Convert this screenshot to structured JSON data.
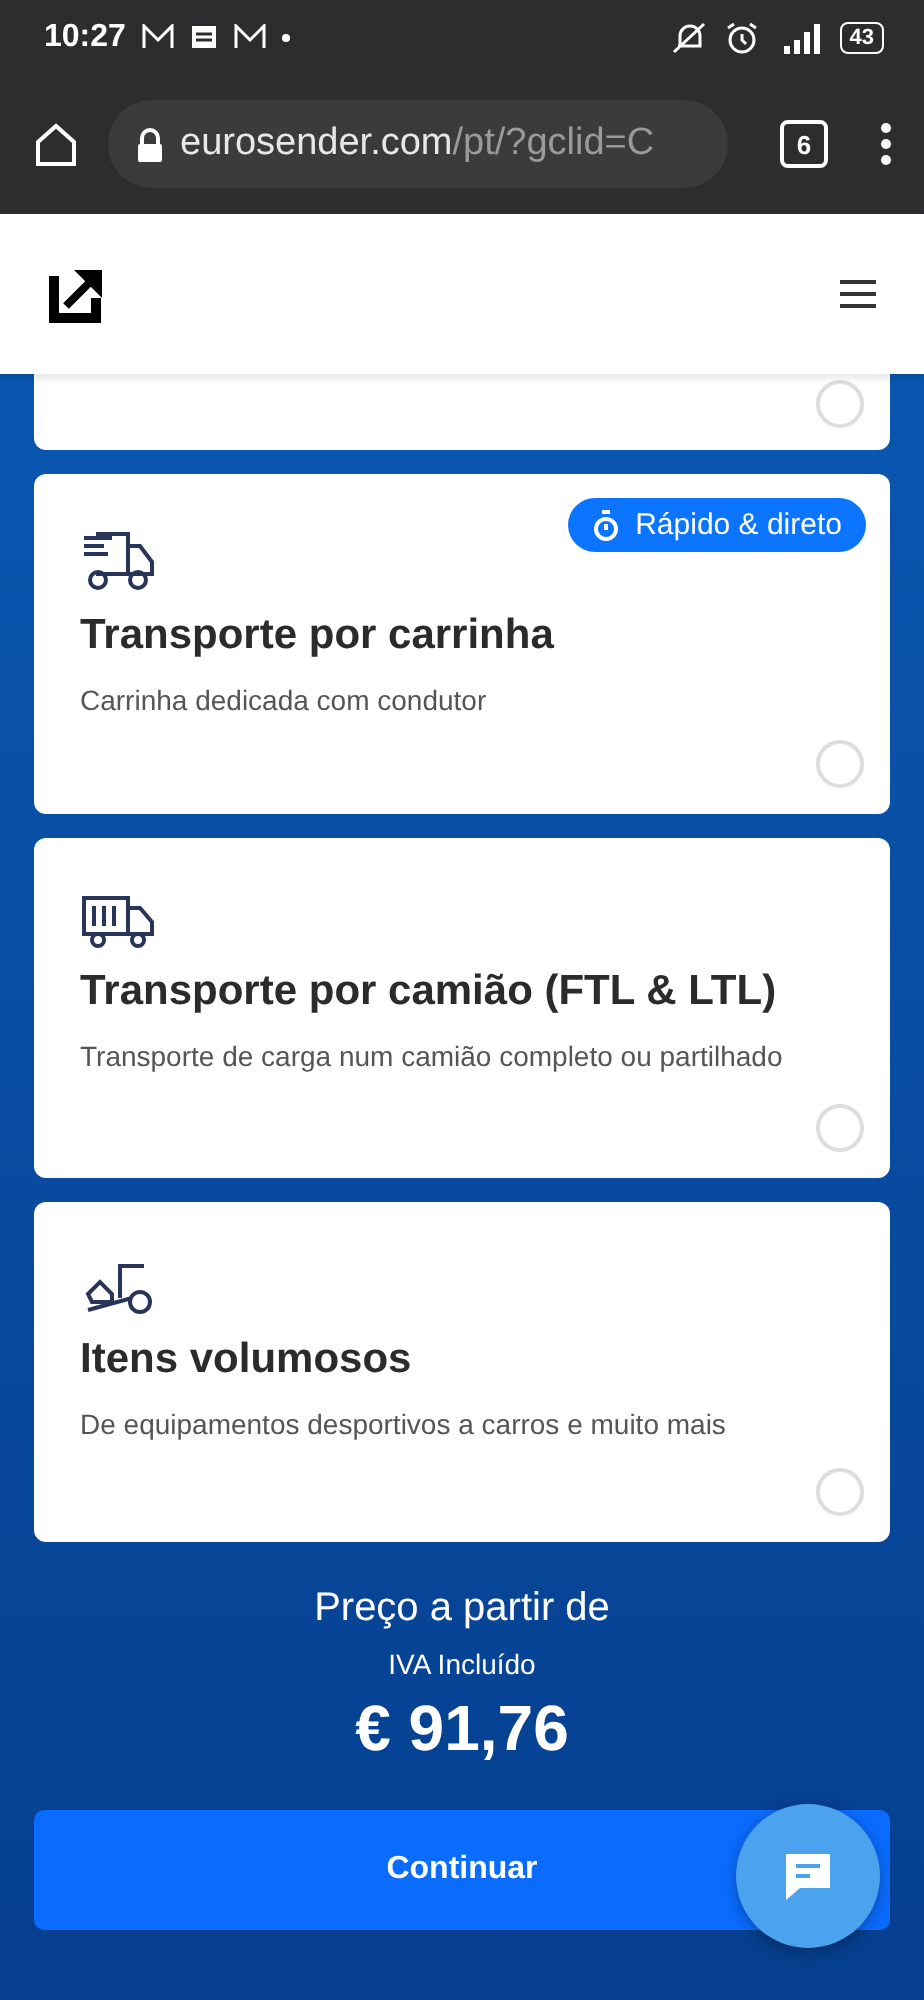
{
  "status_bar": {
    "time": "10:27",
    "battery": "43"
  },
  "browser": {
    "url_host": "eurosender.com",
    "url_path": "/pt/?gclid=C",
    "tab_count": "6"
  },
  "partial_card": {
    "selected": false
  },
  "options": [
    {
      "kind": "van",
      "badge": "Rápido & direto",
      "title": "Transporte por carrinha",
      "description": "Carrinha dedicada com condutor",
      "selected": false
    },
    {
      "kind": "truck",
      "title": "Transporte por camião (FTL & LTL)",
      "description": "Transporte de carga num camião completo ou partilhado",
      "selected": false
    },
    {
      "kind": "bulky",
      "title": "Itens volumosos",
      "description": "De equipamentos desportivos a carros e muito mais",
      "selected": false
    }
  ],
  "price": {
    "label": "Preço a partir de",
    "note": "IVA Incluído",
    "amount": "€ 91,76"
  },
  "continue_button": "Continuar"
}
